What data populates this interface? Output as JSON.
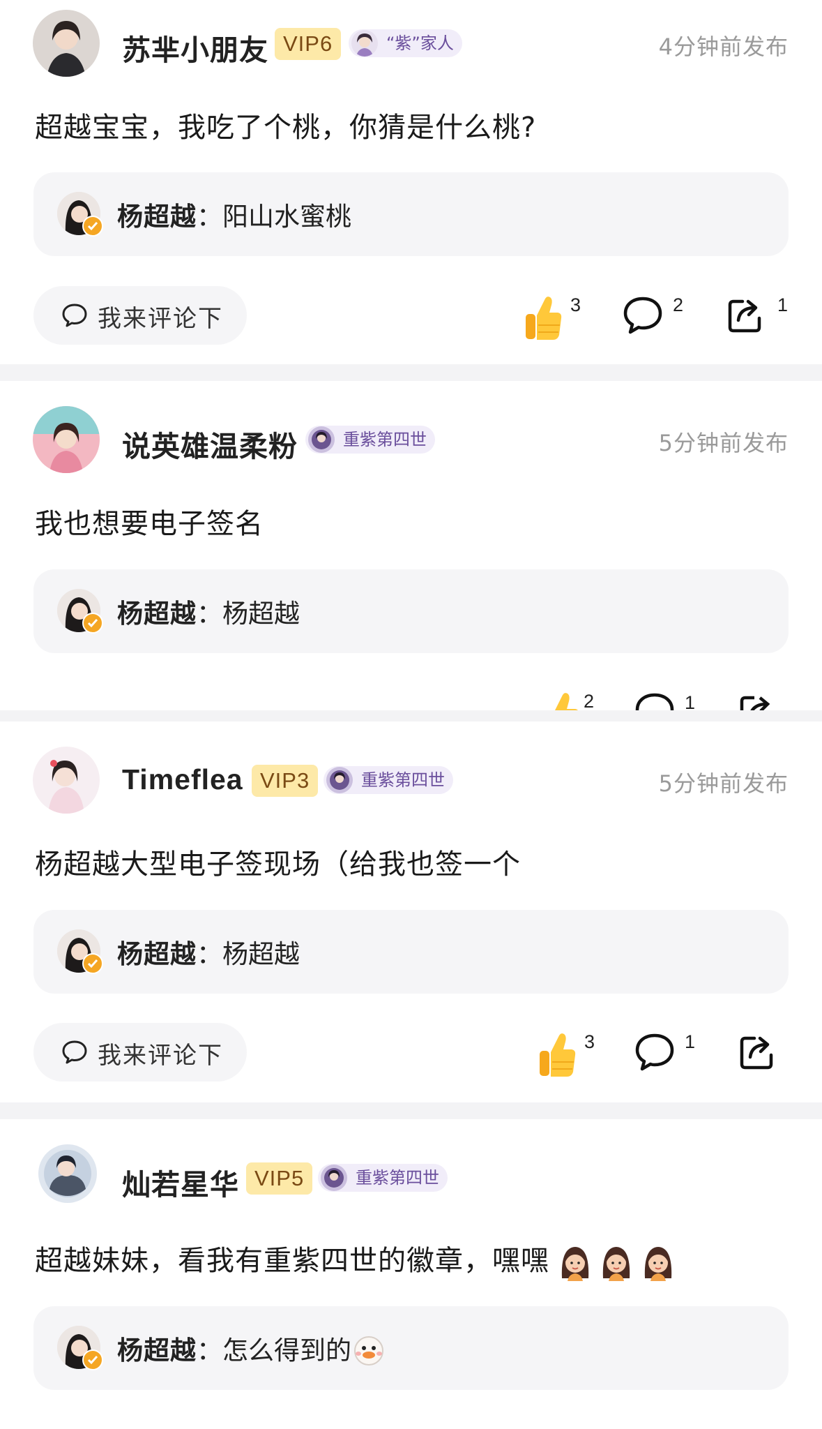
{
  "posts": [
    {
      "username": "苏芈小朋友",
      "vip": "VIP6",
      "badge": "“紫”家人",
      "time": "4分钟前发布",
      "content": "超越宝宝，我吃了个桃，你猜是什么桃?",
      "reply": {
        "name": "杨超越",
        "sep": "：",
        "text": "阳山水蜜桃"
      },
      "comment_button": "我来评论下",
      "likes": "3",
      "comments": "2",
      "shares": "1"
    },
    {
      "username": "说英雄温柔粉",
      "badge": "重紫第四世",
      "time": "5分钟前发布",
      "content": "我也想要电子签名",
      "reply": {
        "name": "杨超越",
        "sep": "：",
        "text": "杨超越"
      },
      "likes": "2",
      "comments": "1"
    },
    {
      "username": "Timeflea",
      "vip": "VIP3",
      "badge": "重紫第四世",
      "time": "5分钟前发布",
      "content": "杨超越大型电子签现场（给我也签一个",
      "reply": {
        "name": "杨超越",
        "sep": "：",
        "text": "杨超越"
      },
      "comment_button": "我来评论下",
      "likes": "3",
      "comments": "1"
    },
    {
      "username": "灿若星华",
      "vip": "VIP5",
      "badge": "重紫第四世",
      "time": "",
      "content": "超越妹妹，看我有重紫四世的徽章，嘿嘿",
      "reply": {
        "name": "杨超越",
        "sep": "：",
        "text": "怎么得到的"
      }
    }
  ],
  "colors": {
    "vip_bg": "#fde9a8",
    "vip_text": "#7a4a14",
    "badge_bg": "#f1edf9",
    "badge_text": "#6a4e9c",
    "like": "#ffbe2e",
    "page_bg": "#f3f3f5"
  },
  "icons": [
    "thumbs-up-icon",
    "comment-bubble-icon",
    "share-icon",
    "verified-icon"
  ]
}
